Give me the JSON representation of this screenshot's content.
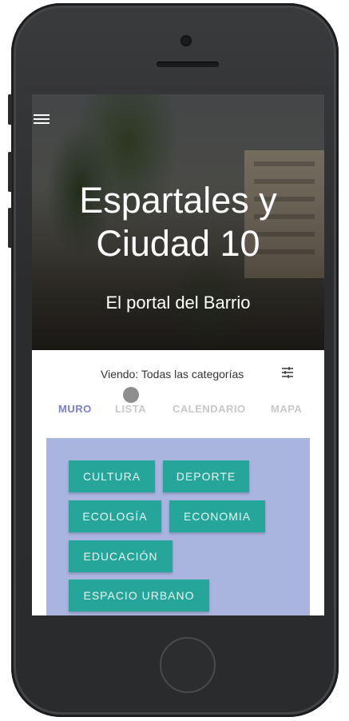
{
  "hero": {
    "title": "Espartales y Ciudad 10",
    "subtitle": "El portal del Barrio"
  },
  "filter": {
    "label": "Viendo: Todas las categorías"
  },
  "tabs": [
    {
      "label": "MURO",
      "active": true
    },
    {
      "label": "LISTA",
      "active": false
    },
    {
      "label": "CALENDARIO",
      "active": false
    },
    {
      "label": "MAPA",
      "active": false
    }
  ],
  "categories": [
    {
      "label": "CULTURA"
    },
    {
      "label": "DEPORTE"
    },
    {
      "label": "ECOLOGÍA"
    },
    {
      "label": "ECONOMIA"
    },
    {
      "label": "EDUCACIÓN"
    },
    {
      "label": "ESPACIO URBANO"
    }
  ],
  "colors": {
    "accent": "#7b7fc9",
    "chip": "#26a69a",
    "panel": "#a9b4df"
  }
}
